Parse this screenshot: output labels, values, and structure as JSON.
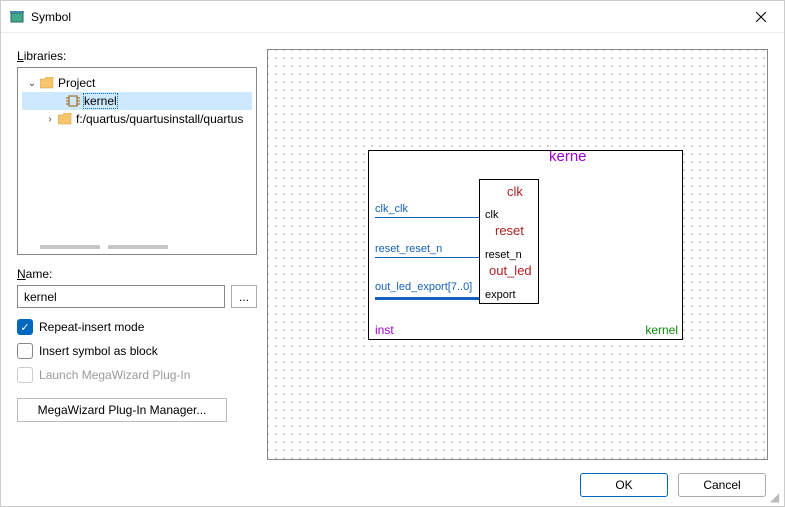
{
  "window": {
    "title": "Symbol"
  },
  "libraries": {
    "label": "Libraries:",
    "items": [
      {
        "expander": "⌄",
        "icon": "folder",
        "text": "Project"
      },
      {
        "expander": "",
        "icon": "component",
        "text": "kernel",
        "selected": true
      },
      {
        "expander": "›",
        "icon": "folder",
        "text": "f:/quartus/quartusinstall/quartus"
      }
    ]
  },
  "name": {
    "label": "Name:",
    "value": "kernel",
    "browse": "..."
  },
  "options": {
    "repeat_insert": {
      "label": "Repeat-insert mode",
      "checked": true
    },
    "insert_block": {
      "label": "Insert symbol as block",
      "checked": false
    },
    "launch_mega": {
      "label": "Launch MegaWizard Plug-In",
      "checked": false,
      "disabled": true
    }
  },
  "megabutton": {
    "label": "MegaWizard Plug-In Manager..."
  },
  "symbol": {
    "title": "kerne",
    "instance": "inst",
    "component": "kernel",
    "sections": [
      {
        "name": "clk",
        "wire_caption": "clk_clk",
        "pin": "clk"
      },
      {
        "name": "reset",
        "wire_caption": "reset_reset_n",
        "pin": "reset_n"
      },
      {
        "name": "out_led",
        "wire_caption": "out_led_export[7..0]",
        "pin": "export"
      }
    ]
  },
  "footer": {
    "ok": "OK",
    "cancel": "Cancel"
  }
}
